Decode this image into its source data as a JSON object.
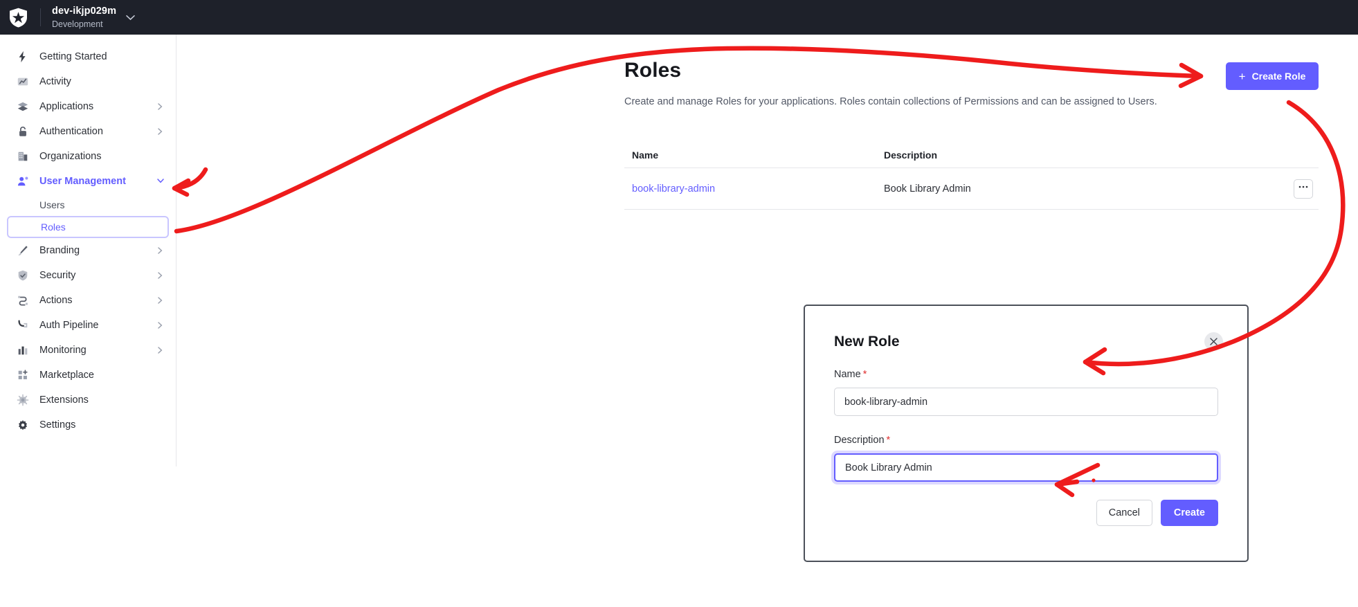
{
  "topbar": {
    "logo_icon": "auth0-shield-logo",
    "tenant_name": "dev-ikjp029m",
    "environment": "Development",
    "caret_icon": "chevron-down-icon"
  },
  "sidebar": {
    "items": [
      {
        "label": "Getting Started",
        "icon": "bolt-icon",
        "expandable": false,
        "active": false
      },
      {
        "label": "Activity",
        "icon": "activity-chart-icon",
        "expandable": false,
        "active": false
      },
      {
        "label": "Applications",
        "icon": "layers-icon",
        "expandable": true,
        "active": false
      },
      {
        "label": "Authentication",
        "icon": "lock-icon",
        "expandable": true,
        "active": false
      },
      {
        "label": "Organizations",
        "icon": "building-icon",
        "expandable": false,
        "active": false
      },
      {
        "label": "User Management",
        "icon": "user-icon",
        "expandable": true,
        "active": true
      },
      {
        "label": "Branding",
        "icon": "brush-icon",
        "expandable": true,
        "active": false
      },
      {
        "label": "Security",
        "icon": "shield-check-icon",
        "expandable": true,
        "active": false
      },
      {
        "label": "Actions",
        "icon": "flow-icon",
        "expandable": true,
        "active": false
      },
      {
        "label": "Auth Pipeline",
        "icon": "pipeline-icon",
        "expandable": true,
        "active": false
      },
      {
        "label": "Monitoring",
        "icon": "bar-chart-icon",
        "expandable": true,
        "active": false
      },
      {
        "label": "Marketplace",
        "icon": "grid-plus-icon",
        "expandable": false,
        "active": false
      },
      {
        "label": "Extensions",
        "icon": "chip-icon",
        "expandable": false,
        "active": false
      },
      {
        "label": "Settings",
        "icon": "gear-icon",
        "expandable": false,
        "active": false
      }
    ],
    "sub_items": [
      {
        "label": "Users",
        "selected": false
      },
      {
        "label": "Roles",
        "selected": true
      }
    ],
    "expand_icon": "chevron-right-icon",
    "collapse_icon": "chevron-down-icon"
  },
  "page": {
    "title": "Roles",
    "description": "Create and manage Roles for your applications. Roles contain collections of Permissions and can be assigned to Users.",
    "create_button": {
      "label": "Create Role",
      "icon": "plus-icon",
      "color": "#635dff"
    }
  },
  "table": {
    "columns": [
      "Name",
      "Description"
    ],
    "rows": [
      {
        "name": "book-library-admin",
        "description": "Book Library Admin",
        "menu_icon": "ellipsis-icon"
      }
    ]
  },
  "modal": {
    "title": "New Role",
    "close_icon": "close-icon",
    "fields": [
      {
        "label": "Name",
        "required_mark": "*",
        "value": "book-library-admin",
        "focused": false
      },
      {
        "label": "Description",
        "required_mark": "*",
        "value": "Book Library Admin",
        "focused": true
      }
    ],
    "cancel_label": "Cancel",
    "create_label": "Create",
    "accent_color": "#635dff"
  },
  "annotations": {
    "color": "#ee1c1c",
    "arrows": [
      {
        "name": "arrow-to-user-management",
        "target": "user-management-chevron"
      },
      {
        "name": "arrow-to-roles-sidebar-item",
        "target": "sidebar-item-roles"
      },
      {
        "name": "arrow-to-create-role-button",
        "target": "create-role-button"
      },
      {
        "name": "arrow-to-new-role-modal",
        "target": "new-role-modal"
      },
      {
        "name": "arrow-to-modal-create-button",
        "target": "modal-create-button"
      }
    ]
  }
}
